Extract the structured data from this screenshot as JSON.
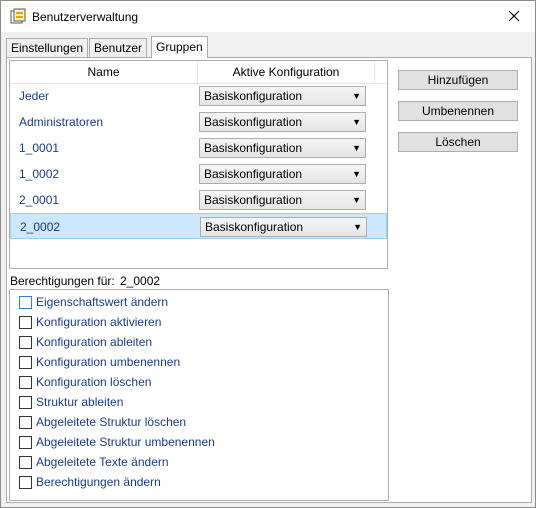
{
  "window": {
    "title": "Benutzerverwaltung"
  },
  "tabs": [
    {
      "label": "Einstellungen",
      "active": false
    },
    {
      "label": "Benutzer",
      "active": false
    },
    {
      "label": "Gruppen",
      "active": true
    }
  ],
  "groups_table": {
    "headers": {
      "name": "Name",
      "config": "Aktive Konfiguration"
    },
    "rows": [
      {
        "name": "Jeder",
        "config": "Basiskonfiguration",
        "selected": false
      },
      {
        "name": "Administratoren",
        "config": "Basiskonfiguration",
        "selected": false
      },
      {
        "name": "1_0001",
        "config": "Basiskonfiguration",
        "selected": false
      },
      {
        "name": "1_0002",
        "config": "Basiskonfiguration",
        "selected": false
      },
      {
        "name": "2_0001",
        "config": "Basiskonfiguration",
        "selected": false
      },
      {
        "name": "2_0002",
        "config": "Basiskonfiguration",
        "selected": true
      }
    ]
  },
  "buttons": {
    "add": "Hinzufügen",
    "rename": "Umbenennen",
    "delete": "Löschen"
  },
  "permissions": {
    "label": "Berechtigungen für:",
    "group": "2_0002",
    "items": [
      {
        "label": "Eigenschaftswert ändern",
        "checked": false
      },
      {
        "label": "Konfiguration aktivieren",
        "checked": false
      },
      {
        "label": "Konfiguration ableiten",
        "checked": false
      },
      {
        "label": "Konfiguration umbenennen",
        "checked": false
      },
      {
        "label": "Konfiguration löschen",
        "checked": false
      },
      {
        "label": "Struktur ableiten",
        "checked": false
      },
      {
        "label": "Abgeleitete Struktur löschen",
        "checked": false
      },
      {
        "label": "Abgeleitete Struktur umbenennen",
        "checked": false
      },
      {
        "label": "Abgeleitete Texte ändern",
        "checked": false
      },
      {
        "label": "Berechtigungen ändern",
        "checked": false
      }
    ]
  },
  "colors": {
    "selection": "#cce8ff",
    "link_text": "#1a3a8a"
  }
}
